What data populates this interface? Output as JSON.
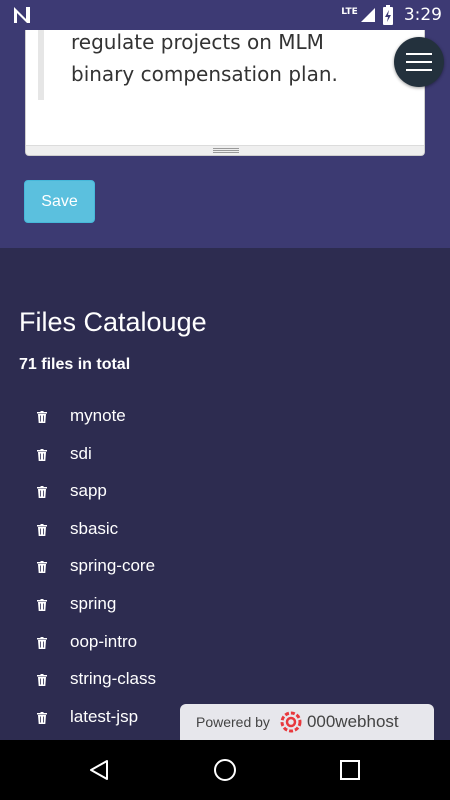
{
  "status_bar": {
    "network": "LTE",
    "time": "3:29",
    "icons": [
      "n-logo-icon",
      "signal-icon",
      "battery-icon"
    ]
  },
  "editor": {
    "text_line1": "regulate projects on MLM",
    "text_line2": "binary compensation plan."
  },
  "save_button": {
    "label": "Save"
  },
  "files": {
    "title": "Files Catalouge",
    "count_text": "71 files in total",
    "items": [
      {
        "name": "mynote"
      },
      {
        "name": "sdi"
      },
      {
        "name": "sapp"
      },
      {
        "name": "sbasic"
      },
      {
        "name": "spring-core"
      },
      {
        "name": "spring"
      },
      {
        "name": "oop-intro"
      },
      {
        "name": "string-class"
      },
      {
        "name": "latest-jsp"
      }
    ]
  },
  "webhost_badge": {
    "powered": "Powered by",
    "brand": "000webhost"
  },
  "colors": {
    "header_bg": "#3c3a72",
    "body_bg": "#2d2c50",
    "save_button": "#5bc0de",
    "fab_bg": "#23313d"
  }
}
